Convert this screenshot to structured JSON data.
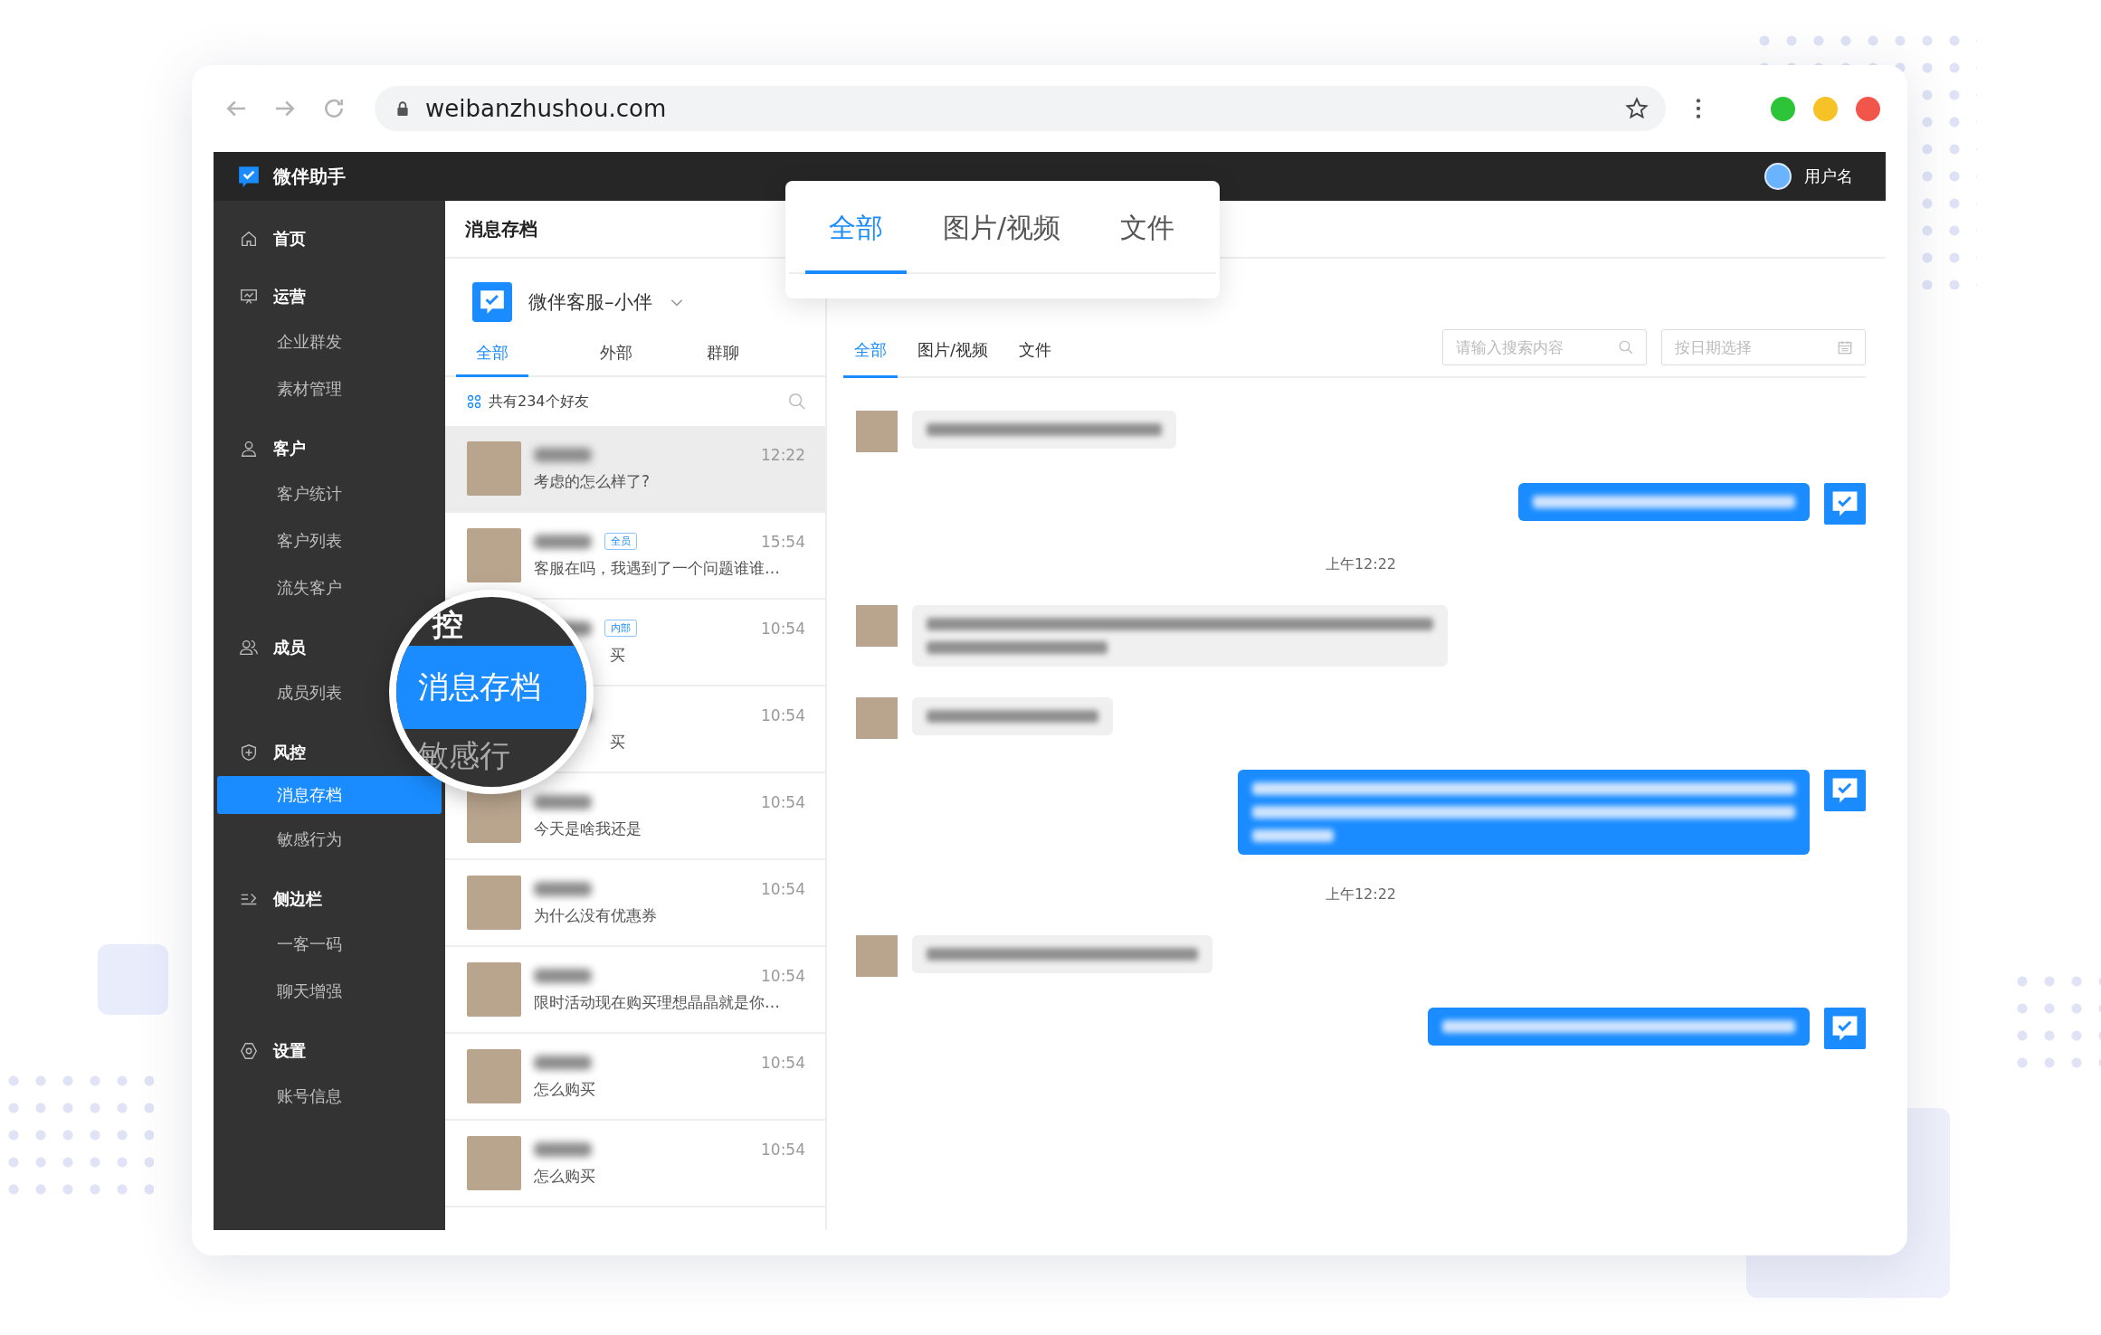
{
  "browser": {
    "url": "weibanzhushou.com"
  },
  "app": {
    "name": "微伴助手",
    "user": "用户名"
  },
  "sidebar": {
    "groups": [
      {
        "label": "首页"
      },
      {
        "label": "运营",
        "children": [
          {
            "label": "企业群发",
            "selected": false
          },
          {
            "label": "素材管理",
            "selected": false
          }
        ]
      },
      {
        "label": "客户",
        "children": [
          {
            "label": "客户统计",
            "selected": false
          },
          {
            "label": "客户列表",
            "selected": false
          },
          {
            "label": "流失客户",
            "selected": false
          }
        ]
      },
      {
        "label": "成员",
        "children": [
          {
            "label": "成员列表",
            "selected": false
          }
        ]
      },
      {
        "label": "风控",
        "children": [
          {
            "label": "消息存档",
            "selected": true
          },
          {
            "label": "敏感行为",
            "selected": false
          }
        ]
      },
      {
        "label": "侧边栏",
        "children": [
          {
            "label": "一客一码",
            "selected": false
          },
          {
            "label": "聊天增强",
            "selected": false
          }
        ]
      },
      {
        "label": "设置",
        "children": [
          {
            "label": "账号信息",
            "selected": false
          }
        ]
      }
    ]
  },
  "page_title": "消息存档",
  "conversations": {
    "account": "微伴客服–小伴",
    "tabs": [
      {
        "label": "全部",
        "selected": true
      },
      {
        "label": "外部",
        "selected": false
      },
      {
        "label": "群聊",
        "selected": false
      }
    ],
    "count": "共有234个好友",
    "rows": [
      {
        "kind": "full",
        "time": "12:22",
        "preview": "考虑的怎么样了?",
        "selected": true
      },
      {
        "kind": "full",
        "time": "15:54",
        "badge": "全员",
        "preview": "客服在吗，我遇到了一个问题谁谁…",
        "selected": false
      },
      {
        "kind": "partial",
        "time": "10:54",
        "badge": "内部",
        "preview": "买",
        "selected": false
      },
      {
        "kind": "partial",
        "time": "10:54",
        "preview": "买",
        "selected": false
      },
      {
        "kind": "full",
        "time": "10:54",
        "preview": "今天是啥我还是",
        "selected": false
      },
      {
        "kind": "full",
        "time": "10:54",
        "preview": "为什么没有优惠券",
        "selected": false
      },
      {
        "kind": "full",
        "time": "10:54",
        "preview": "限时活动现在购买理想晶晶就是你…",
        "selected": false
      },
      {
        "kind": "full",
        "time": "10:54",
        "preview": "怎么购买",
        "selected": false
      },
      {
        "kind": "full",
        "time": "10:54",
        "preview": "怎么购买",
        "selected": false
      }
    ]
  },
  "chat": {
    "tabs": [
      {
        "label": "全部",
        "selected": true
      },
      {
        "label": "图片/视频",
        "selected": false
      },
      {
        "label": "文件",
        "selected": false
      }
    ],
    "search": {
      "placeholder": "请输入搜索内容"
    },
    "date": {
      "placeholder": "按日期选择"
    },
    "messages": [
      {
        "kind": "in"
      },
      {
        "kind": "out"
      },
      {
        "kind": "time",
        "text": "上午12:22"
      },
      {
        "kind": "in"
      },
      {
        "kind": "in"
      },
      {
        "kind": "out"
      },
      {
        "kind": "time",
        "text": "上午12:22"
      },
      {
        "kind": "in"
      },
      {
        "kind": "out"
      }
    ]
  },
  "callout": {
    "tabs": [
      {
        "label": "全部",
        "selected": true
      },
      {
        "label": "图片/视频",
        "selected": false
      },
      {
        "label": "文件",
        "selected": false
      }
    ]
  },
  "magnifier": {
    "lines": [
      {
        "kind": "group",
        "text": "控"
      },
      {
        "kind": "active",
        "text": "消息存档"
      },
      {
        "kind": "item",
        "text": "敏感行"
      }
    ]
  }
}
